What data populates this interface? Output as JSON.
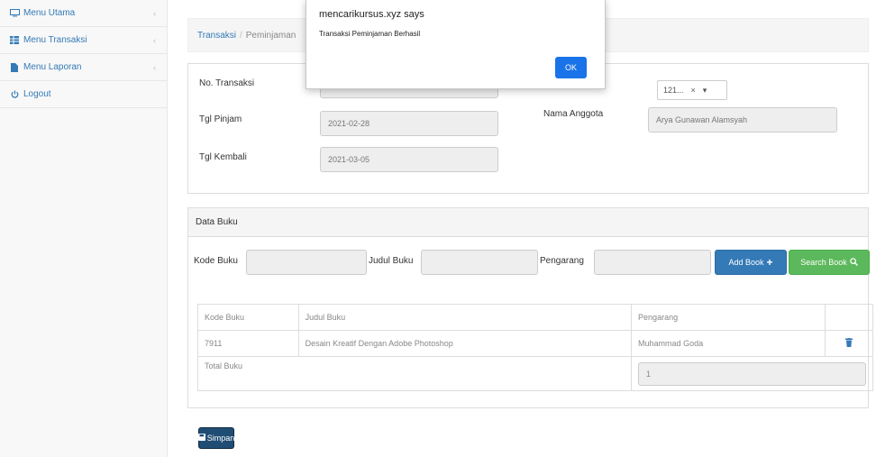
{
  "sidebar": {
    "items": [
      {
        "label": "Menu Utama",
        "icon": "monitor-icon"
      },
      {
        "label": "Menu Transaksi",
        "icon": "table-icon"
      },
      {
        "label": "Menu Laporan",
        "icon": "file-icon"
      },
      {
        "label": "Logout",
        "icon": "power-icon"
      }
    ]
  },
  "breadcrumb": {
    "first": "Transaksi",
    "second": "Peminjaman"
  },
  "form": {
    "no_transaksi_label": "No. Transaksi",
    "tgl_pinjam_label": "Tgl Pinjam",
    "tgl_pinjam_value": "2021-02-28",
    "tgl_kembali_label": "Tgl Kembali",
    "tgl_kembali_value": "2021-03-05",
    "anggota_select": "121...",
    "nama_anggota_label": "Nama Anggota",
    "nama_anggota_value": "Arya Gunawan Alamsyah"
  },
  "buku": {
    "panel_title": "Data Buku",
    "kode_label": "Kode Buku",
    "judul_label": "Judul Buku",
    "pengarang_label": "Pengarang",
    "add_button": "Add Book",
    "search_button": "Search Book",
    "table": {
      "headers": [
        "Kode Buku",
        "Judul Buku",
        "Pengarang"
      ],
      "rows": [
        {
          "kode": "7911",
          "judul": "Desain Kreatif Dengan Adobe Photoshop",
          "pengarang": "Muhammad Goda"
        }
      ],
      "total_label": "Total Buku",
      "total_value": "1"
    }
  },
  "save_button": "Simpan",
  "alert": {
    "title": "mencarikursus.xyz says",
    "message": "Transaksi Peminjaman Berhasil",
    "ok": "OK"
  },
  "colors": {
    "primary": "#337ab7",
    "success": "#5cb85c",
    "dialog_ok": "#1a73e8"
  }
}
